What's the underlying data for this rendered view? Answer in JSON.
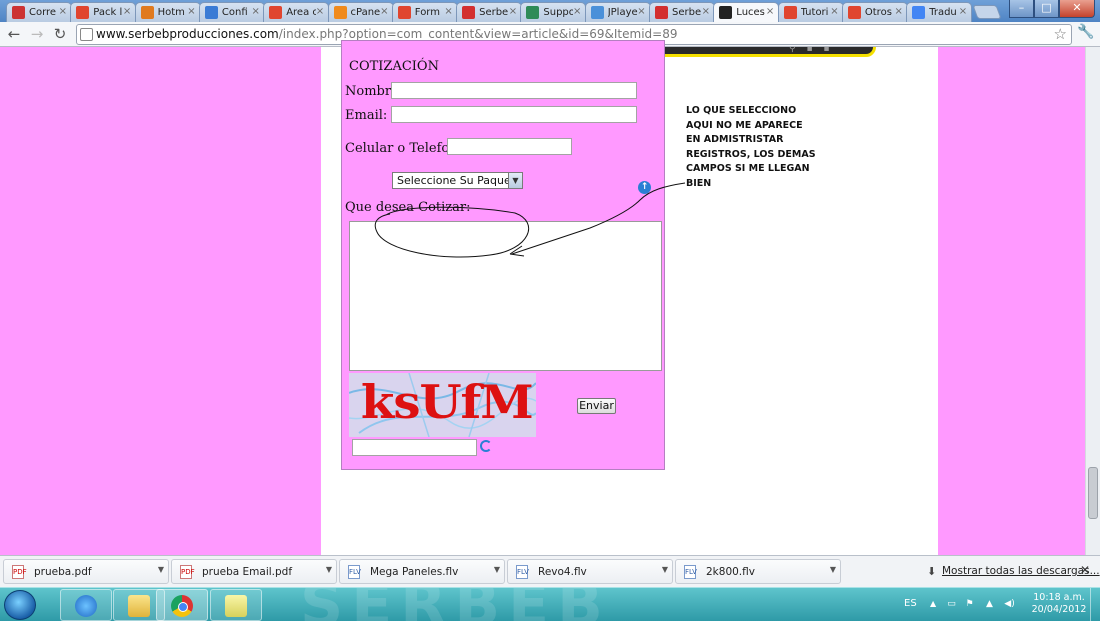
{
  "browser": {
    "tabs": [
      {
        "label": "Corre",
        "favicon": "gmail-icon",
        "color": "#c33"
      },
      {
        "label": "Pack l",
        "favicon": "w-icon",
        "color": "#e0452f"
      },
      {
        "label": "Hotm",
        "favicon": "hotmail-icon",
        "color": "#e07a1f"
      },
      {
        "label": "Confi",
        "favicon": "google-icon",
        "color": "#3a7bd5"
      },
      {
        "label": "Área c",
        "favicon": "w-icon",
        "color": "#e0452f"
      },
      {
        "label": "cPane",
        "favicon": "cpanel-icon",
        "color": "#f08a1c"
      },
      {
        "label": "Form",
        "favicon": "w-icon",
        "color": "#e0452f"
      },
      {
        "label": "Serbe",
        "favicon": "joomla-icon",
        "color": "#d32f2f"
      },
      {
        "label": "Suppo",
        "favicon": "support-icon",
        "color": "#2e8b57"
      },
      {
        "label": "JPlaye",
        "favicon": "jplayer-icon",
        "color": "#4a90d9"
      },
      {
        "label": "Serbe",
        "favicon": "joomla-icon",
        "color": "#d32f2f"
      },
      {
        "label": "Luces",
        "favicon": "luces-icon",
        "color": "#222222"
      },
      {
        "label": "Tutori",
        "favicon": "w-icon",
        "color": "#e0452f"
      },
      {
        "label": "Otros",
        "favicon": "w-icon",
        "color": "#e0452f"
      },
      {
        "label": "Tradu",
        "favicon": "translate-icon",
        "color": "#4285f4"
      }
    ],
    "active_tab": 11,
    "url_host": "www.serbebproducciones.com",
    "url_rest": "/index.php?option=com_content&view=article&id=69&Itemid=89"
  },
  "page": {
    "colors": {
      "background": "#ff99ff",
      "content": "#ffffff"
    },
    "form": {
      "title": "COTIZACIÓN",
      "nombre_label": "Nombre:",
      "nombre_value": "",
      "email_label": "Email:",
      "email_value": "",
      "telefono_label": "Celular o Telefono:",
      "telefono_value": "",
      "paquete_selected": "Seleccione Su Paquete",
      "cotizar_label": "Que desea Cotizar:",
      "cotizar_value": "",
      "captcha_text": "ksUfM",
      "captcha_input": "",
      "submit_label": "Enviar"
    },
    "annotation_lines": [
      "LO QUE SELECCIONO",
      "AQUI NO ME APARECE",
      "EN ADMISTRISTAR",
      "REGISTROS, LOS DEMAS",
      "CAMPOS SI ME LLEGAN",
      "BIEN"
    ],
    "info_icon_glyph": "↑"
  },
  "downloads": {
    "items": [
      {
        "name": "prueba.pdf",
        "icon": "pdf-icon",
        "type": "PDF"
      },
      {
        "name": "prueba Email.pdf",
        "icon": "pdf-icon",
        "type": "PDF"
      },
      {
        "name": "Mega Paneles.flv",
        "icon": "flv-icon",
        "type": "FLV"
      },
      {
        "name": "Revo4.flv",
        "icon": "flv-icon",
        "type": "FLV"
      },
      {
        "name": "2k800.flv",
        "icon": "flv-icon",
        "type": "FLV"
      }
    ],
    "show_all_label": "Mostrar todas las descargas..."
  },
  "taskbar": {
    "watermark": "SERBEB",
    "lang": "ES",
    "time": "10:18 a.m.",
    "date": "20/04/2012"
  }
}
